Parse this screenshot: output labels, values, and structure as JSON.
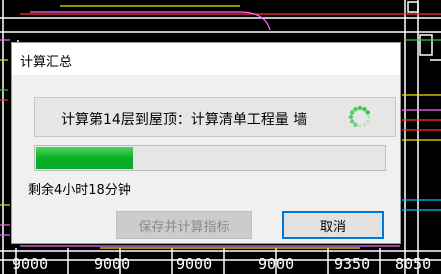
{
  "dialog": {
    "title": "计算汇总",
    "message": "计算第14层到屋顶：计算清单工程量 墙",
    "progress": 0.28,
    "remaining": "剩余4小时18分钟",
    "buttons": {
      "save_label": "保存并计算指标",
      "cancel_label": "取消"
    }
  },
  "cad": {
    "dimensions": [
      "9000",
      "9000",
      "9000",
      "9000",
      "9350",
      "8050"
    ]
  },
  "colors": {
    "progress_green": "#06b025",
    "cancel_border": "#0078d7",
    "spinner_green": "#22c73a"
  },
  "icons": {
    "spinner": "loading-spinner-icon"
  }
}
